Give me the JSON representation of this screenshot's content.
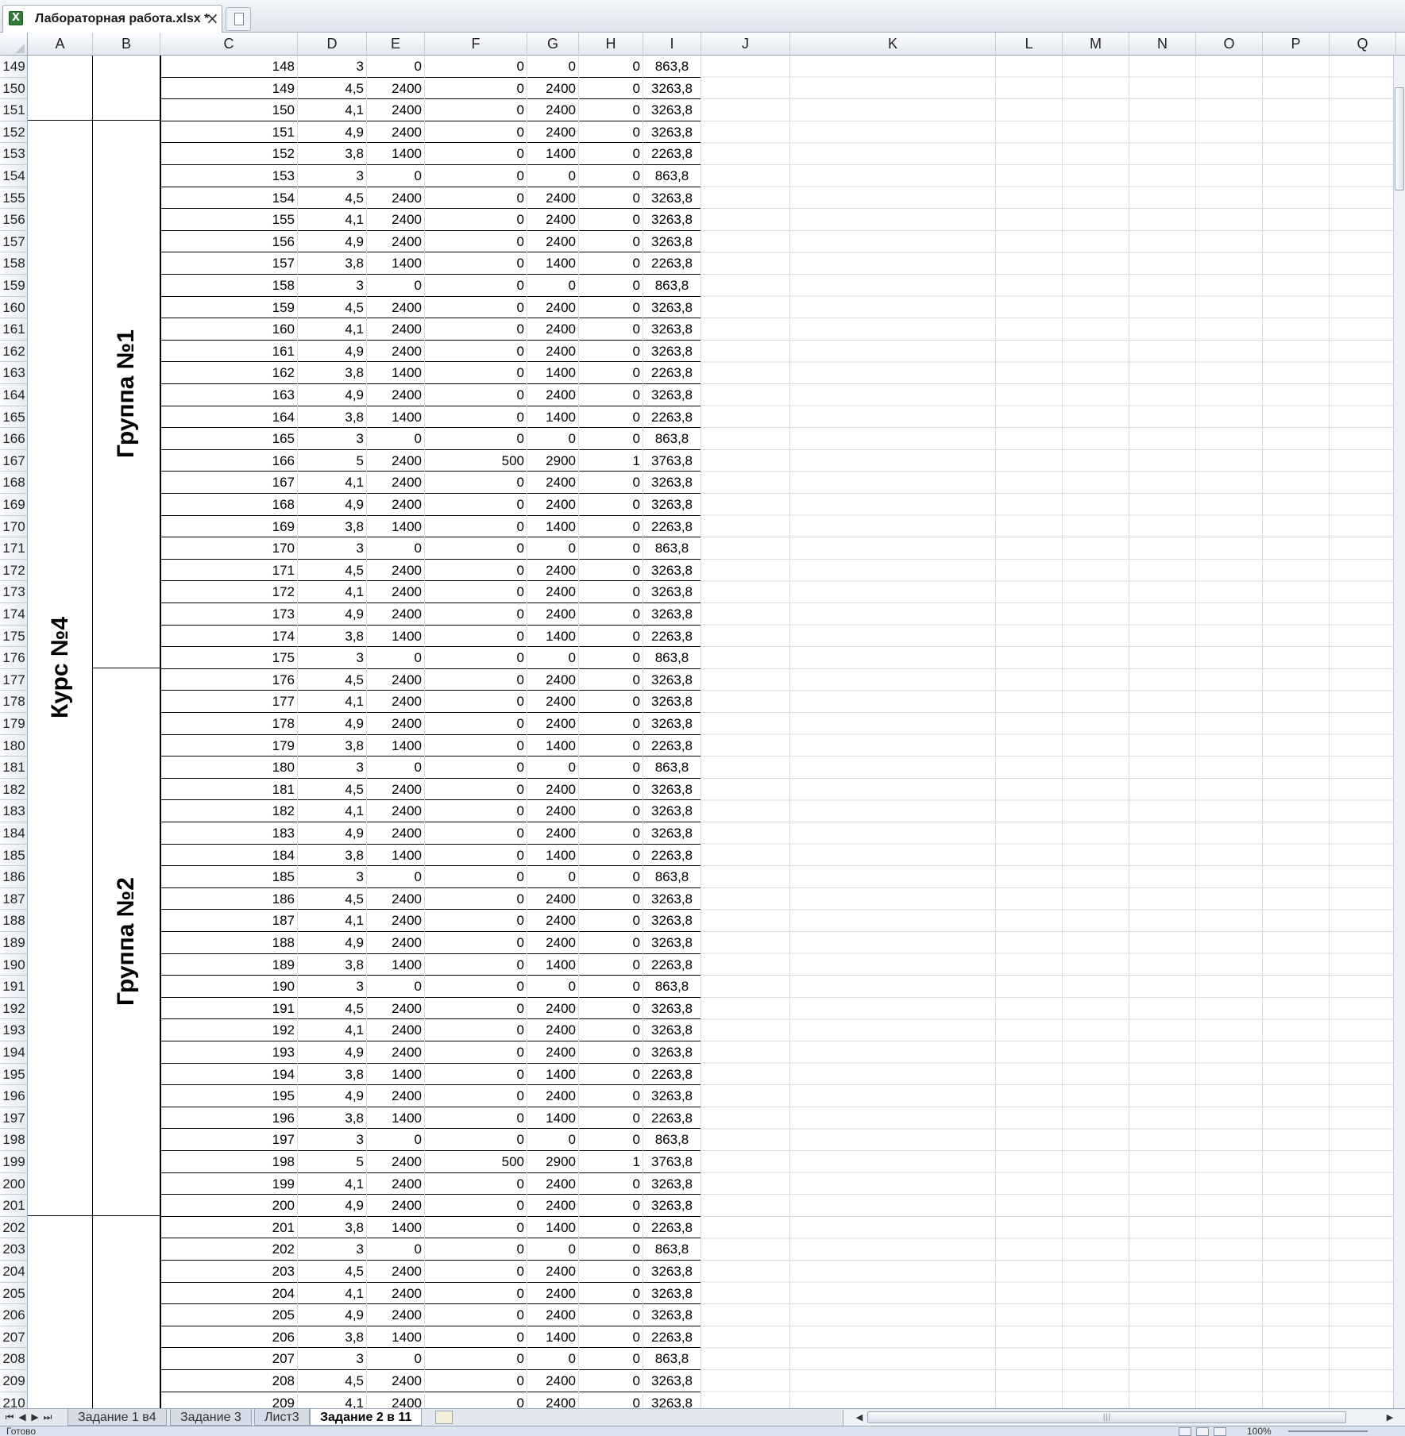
{
  "window": {
    "document_tab": "Лабораторная работа.xlsx *",
    "close_glyph": "×"
  },
  "columns": [
    "A",
    "B",
    "C",
    "D",
    "E",
    "F",
    "G",
    "H",
    "I",
    "J",
    "K",
    "L",
    "M",
    "N",
    "O",
    "P",
    "Q"
  ],
  "merged_labels": {
    "course": "Курс №4",
    "group1": "Группа №1",
    "group2": "Группа №2"
  },
  "first_row_number": 149,
  "table": [
    [
      "148",
      "3",
      "0",
      "0",
      "0",
      "0",
      "863,8"
    ],
    [
      "149",
      "4,5",
      "2400",
      "0",
      "2400",
      "0",
      "3263,8"
    ],
    [
      "150",
      "4,1",
      "2400",
      "0",
      "2400",
      "0",
      "3263,8"
    ],
    [
      "151",
      "4,9",
      "2400",
      "0",
      "2400",
      "0",
      "3263,8"
    ],
    [
      "152",
      "3,8",
      "1400",
      "0",
      "1400",
      "0",
      "2263,8"
    ],
    [
      "153",
      "3",
      "0",
      "0",
      "0",
      "0",
      "863,8"
    ],
    [
      "154",
      "4,5",
      "2400",
      "0",
      "2400",
      "0",
      "3263,8"
    ],
    [
      "155",
      "4,1",
      "2400",
      "0",
      "2400",
      "0",
      "3263,8"
    ],
    [
      "156",
      "4,9",
      "2400",
      "0",
      "2400",
      "0",
      "3263,8"
    ],
    [
      "157",
      "3,8",
      "1400",
      "0",
      "1400",
      "0",
      "2263,8"
    ],
    [
      "158",
      "3",
      "0",
      "0",
      "0",
      "0",
      "863,8"
    ],
    [
      "159",
      "4,5",
      "2400",
      "0",
      "2400",
      "0",
      "3263,8"
    ],
    [
      "160",
      "4,1",
      "2400",
      "0",
      "2400",
      "0",
      "3263,8"
    ],
    [
      "161",
      "4,9",
      "2400",
      "0",
      "2400",
      "0",
      "3263,8"
    ],
    [
      "162",
      "3,8",
      "1400",
      "0",
      "1400",
      "0",
      "2263,8"
    ],
    [
      "163",
      "4,9",
      "2400",
      "0",
      "2400",
      "0",
      "3263,8"
    ],
    [
      "164",
      "3,8",
      "1400",
      "0",
      "1400",
      "0",
      "2263,8"
    ],
    [
      "165",
      "3",
      "0",
      "0",
      "0",
      "0",
      "863,8"
    ],
    [
      "166",
      "5",
      "2400",
      "500",
      "2900",
      "1",
      "3763,8"
    ],
    [
      "167",
      "4,1",
      "2400",
      "0",
      "2400",
      "0",
      "3263,8"
    ],
    [
      "168",
      "4,9",
      "2400",
      "0",
      "2400",
      "0",
      "3263,8"
    ],
    [
      "169",
      "3,8",
      "1400",
      "0",
      "1400",
      "0",
      "2263,8"
    ],
    [
      "170",
      "3",
      "0",
      "0",
      "0",
      "0",
      "863,8"
    ],
    [
      "171",
      "4,5",
      "2400",
      "0",
      "2400",
      "0",
      "3263,8"
    ],
    [
      "172",
      "4,1",
      "2400",
      "0",
      "2400",
      "0",
      "3263,8"
    ],
    [
      "173",
      "4,9",
      "2400",
      "0",
      "2400",
      "0",
      "3263,8"
    ],
    [
      "174",
      "3,8",
      "1400",
      "0",
      "1400",
      "0",
      "2263,8"
    ],
    [
      "175",
      "3",
      "0",
      "0",
      "0",
      "0",
      "863,8"
    ],
    [
      "176",
      "4,5",
      "2400",
      "0",
      "2400",
      "0",
      "3263,8"
    ],
    [
      "177",
      "4,1",
      "2400",
      "0",
      "2400",
      "0",
      "3263,8"
    ],
    [
      "178",
      "4,9",
      "2400",
      "0",
      "2400",
      "0",
      "3263,8"
    ],
    [
      "179",
      "3,8",
      "1400",
      "0",
      "1400",
      "0",
      "2263,8"
    ],
    [
      "180",
      "3",
      "0",
      "0",
      "0",
      "0",
      "863,8"
    ],
    [
      "181",
      "4,5",
      "2400",
      "0",
      "2400",
      "0",
      "3263,8"
    ],
    [
      "182",
      "4,1",
      "2400",
      "0",
      "2400",
      "0",
      "3263,8"
    ],
    [
      "183",
      "4,9",
      "2400",
      "0",
      "2400",
      "0",
      "3263,8"
    ],
    [
      "184",
      "3,8",
      "1400",
      "0",
      "1400",
      "0",
      "2263,8"
    ],
    [
      "185",
      "3",
      "0",
      "0",
      "0",
      "0",
      "863,8"
    ],
    [
      "186",
      "4,5",
      "2400",
      "0",
      "2400",
      "0",
      "3263,8"
    ],
    [
      "187",
      "4,1",
      "2400",
      "0",
      "2400",
      "0",
      "3263,8"
    ],
    [
      "188",
      "4,9",
      "2400",
      "0",
      "2400",
      "0",
      "3263,8"
    ],
    [
      "189",
      "3,8",
      "1400",
      "0",
      "1400",
      "0",
      "2263,8"
    ],
    [
      "190",
      "3",
      "0",
      "0",
      "0",
      "0",
      "863,8"
    ],
    [
      "191",
      "4,5",
      "2400",
      "0",
      "2400",
      "0",
      "3263,8"
    ],
    [
      "192",
      "4,1",
      "2400",
      "0",
      "2400",
      "0",
      "3263,8"
    ],
    [
      "193",
      "4,9",
      "2400",
      "0",
      "2400",
      "0",
      "3263,8"
    ],
    [
      "194",
      "3,8",
      "1400",
      "0",
      "1400",
      "0",
      "2263,8"
    ],
    [
      "195",
      "4,9",
      "2400",
      "0",
      "2400",
      "0",
      "3263,8"
    ],
    [
      "196",
      "3,8",
      "1400",
      "0",
      "1400",
      "0",
      "2263,8"
    ],
    [
      "197",
      "3",
      "0",
      "0",
      "0",
      "0",
      "863,8"
    ],
    [
      "198",
      "5",
      "2400",
      "500",
      "2900",
      "1",
      "3763,8"
    ],
    [
      "199",
      "4,1",
      "2400",
      "0",
      "2400",
      "0",
      "3263,8"
    ],
    [
      "200",
      "4,9",
      "2400",
      "0",
      "2400",
      "0",
      "3263,8"
    ],
    [
      "201",
      "3,8",
      "1400",
      "0",
      "1400",
      "0",
      "2263,8"
    ],
    [
      "202",
      "3",
      "0",
      "0",
      "0",
      "0",
      "863,8"
    ],
    [
      "203",
      "4,5",
      "2400",
      "0",
      "2400",
      "0",
      "3263,8"
    ],
    [
      "204",
      "4,1",
      "2400",
      "0",
      "2400",
      "0",
      "3263,8"
    ],
    [
      "205",
      "4,9",
      "2400",
      "0",
      "2400",
      "0",
      "3263,8"
    ],
    [
      "206",
      "3,8",
      "1400",
      "0",
      "1400",
      "0",
      "2263,8"
    ],
    [
      "207",
      "3",
      "0",
      "0",
      "0",
      "0",
      "863,8"
    ],
    [
      "208",
      "4,5",
      "2400",
      "0",
      "2400",
      "0",
      "3263,8"
    ],
    [
      "209",
      "4,1",
      "2400",
      "0",
      "2400",
      "0",
      "3263,8"
    ]
  ],
  "sheet_tabs": [
    {
      "label": "Задание 1 в4",
      "active": false
    },
    {
      "label": "Задание 3",
      "active": false
    },
    {
      "label": "Лист3",
      "active": false
    },
    {
      "label": "Задание 2 в 11",
      "active": true
    }
  ],
  "status": {
    "ready_text": "Готово",
    "zoom_text": "100%"
  },
  "icons": {
    "excel": "excel-file-icon",
    "new_sheet": "insert-sheet-icon",
    "scroll_grip": "|||"
  }
}
